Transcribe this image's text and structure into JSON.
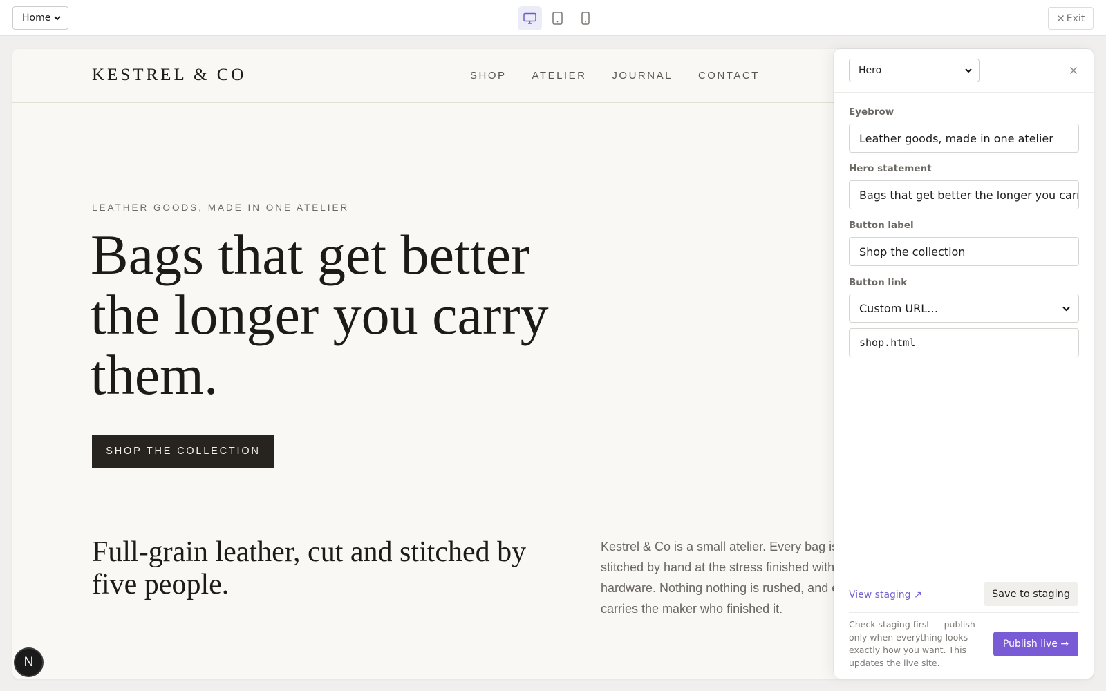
{
  "toolbar": {
    "page_select": "Home",
    "devices": [
      {
        "name": "desktop",
        "active": true
      },
      {
        "name": "tablet",
        "active": false
      },
      {
        "name": "mobile",
        "active": false
      }
    ],
    "exit_label": "Exit"
  },
  "site": {
    "logo": "KESTREL & CO",
    "nav": [
      "SHOP",
      "ATELIER",
      "JOURNAL",
      "CONTACT"
    ],
    "hero": {
      "eyebrow": "LEATHER GOODS, MADE IN ONE ATELIER",
      "title": "Bags that get better the longer you carry them.",
      "cta": "SHOP THE COLLECTION"
    },
    "about": {
      "title": "Full-grain leather, cut and stitched by five people.",
      "body": "Kestrel & Co is a small atelier. Every bag is grain hides, stitched by hand at the stress finished with solid brass hardware. Nothing nothing is rushed, and every piece carries the maker who finished it."
    }
  },
  "editor": {
    "section_select": "Hero",
    "fields": {
      "eyebrow_label": "Eyebrow",
      "eyebrow_value": "Leather goods, made in one atelier",
      "statement_label": "Hero statement",
      "statement_value": "Bags that get better the longer you carry them.",
      "button_label_label": "Button label",
      "button_label_value": "Shop the collection",
      "button_link_label": "Button link",
      "button_link_option": "Custom URL…",
      "button_link_url": "shop.html"
    },
    "footer": {
      "view_staging": "View staging ↗",
      "save": "Save to staging",
      "help": "Check staging first — publish only when everything looks exactly how you want. This updates the live site.",
      "publish": "Publish live →"
    }
  },
  "badge": "N",
  "colors": {
    "accent": "#7a5bd6",
    "page_bg": "#faf8f5",
    "cta_bg": "#27231f"
  }
}
